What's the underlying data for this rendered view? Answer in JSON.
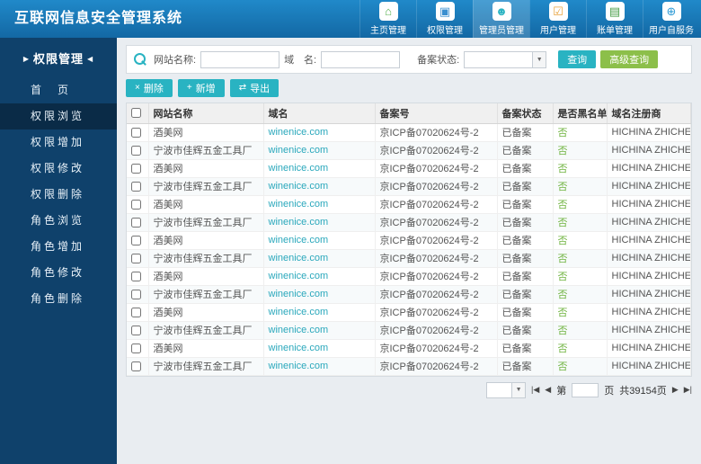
{
  "colors": {
    "teal": "#29b3c2",
    "green": "#8cbf4a",
    "link": "#2aa8bc",
    "ok_green": "#6fb33f"
  },
  "header": {
    "title": "互联网信息安全管理系统",
    "nav": [
      {
        "label": "主页管理",
        "icon": "home-icon",
        "glyph": "⌂",
        "color": "#55b04e",
        "active": false
      },
      {
        "label": "权限管理",
        "icon": "permission-icon",
        "glyph": "▣",
        "color": "#3a8fd0",
        "active": false
      },
      {
        "label": "管理员管理",
        "icon": "admin-icon",
        "glyph": "☻",
        "color": "#29b3c2",
        "active": true
      },
      {
        "label": "用户管理",
        "icon": "user-icon",
        "glyph": "☑",
        "color": "#e8a33d",
        "active": false
      },
      {
        "label": "账单管理",
        "icon": "billing-icon",
        "glyph": "▤",
        "color": "#4a9e4a",
        "active": false
      },
      {
        "label": "用户自服务",
        "icon": "globe-icon",
        "glyph": "⊕",
        "color": "#2f9bd6",
        "active": false
      }
    ]
  },
  "sidebar": {
    "title": "权限管理",
    "title_left_icon": "▶",
    "title_right_icon": "◀",
    "items": [
      {
        "label": "首　页",
        "active": false
      },
      {
        "label": "权限浏览",
        "active": true
      },
      {
        "label": "权限增加",
        "active": false
      },
      {
        "label": "权限修改",
        "active": false
      },
      {
        "label": "权限删除",
        "active": false
      },
      {
        "label": "角色浏览",
        "active": false
      },
      {
        "label": "角色增加",
        "active": false
      },
      {
        "label": "角色修改",
        "active": false
      },
      {
        "label": "角色删除",
        "active": false
      }
    ]
  },
  "search": {
    "site_name_label": "网站名称:",
    "site_name_value": "",
    "domain_label": "域　名:",
    "domain_value": "",
    "status_label": "备案状态:",
    "status_value": "",
    "query_button": "查询",
    "advanced_button": "高级查询"
  },
  "toolbar": {
    "delete_icon": "×",
    "delete_label": "删除",
    "add_icon": "+",
    "add_label": "新增",
    "export_icon": "⇄",
    "export_label": "导出"
  },
  "table": {
    "columns": [
      "网站名称",
      "域名",
      "备案号",
      "备案状态",
      "是否黑名单",
      "域名注册商"
    ],
    "rows": [
      {
        "name": "酒美网",
        "domain": "winenice.com",
        "record_no": "京ICP备07020624号-2",
        "status": "已备案",
        "blacklist": "否",
        "registrar": "HICHINA ZHICHENG TECHNOLOGY"
      },
      {
        "name": "宁波市佳辉五金工具厂",
        "domain": "winenice.com",
        "record_no": "京ICP备07020624号-2",
        "status": "已备案",
        "blacklist": "否",
        "registrar": "HICHINA ZHICHENG TECHNOLOGY"
      },
      {
        "name": "酒美网",
        "domain": "winenice.com",
        "record_no": "京ICP备07020624号-2",
        "status": "已备案",
        "blacklist": "否",
        "registrar": "HICHINA ZHICHENG TECHNOLOGY"
      },
      {
        "name": "宁波市佳辉五金工具厂",
        "domain": "winenice.com",
        "record_no": "京ICP备07020624号-2",
        "status": "已备案",
        "blacklist": "否",
        "registrar": "HICHINA ZHICHENG TECHNOLOGY"
      },
      {
        "name": "酒美网",
        "domain": "winenice.com",
        "record_no": "京ICP备07020624号-2",
        "status": "已备案",
        "blacklist": "否",
        "registrar": "HICHINA ZHICHENG TECHNOLOGY"
      },
      {
        "name": "宁波市佳辉五金工具厂",
        "domain": "winenice.com",
        "record_no": "京ICP备07020624号-2",
        "status": "已备案",
        "blacklist": "否",
        "registrar": "HICHINA ZHICHENG TECHNOLOGY"
      },
      {
        "name": "酒美网",
        "domain": "winenice.com",
        "record_no": "京ICP备07020624号-2",
        "status": "已备案",
        "blacklist": "否",
        "registrar": "HICHINA ZHICHENG TECHNOLOGY"
      },
      {
        "name": "宁波市佳辉五金工具厂",
        "domain": "winenice.com",
        "record_no": "京ICP备07020624号-2",
        "status": "已备案",
        "blacklist": "否",
        "registrar": "HICHINA ZHICHENG TECHNOLOGY"
      },
      {
        "name": "酒美网",
        "domain": "winenice.com",
        "record_no": "京ICP备07020624号-2",
        "status": "已备案",
        "blacklist": "否",
        "registrar": "HICHINA ZHICHENG TECHNOLOGY"
      },
      {
        "name": "宁波市佳辉五金工具厂",
        "domain": "winenice.com",
        "record_no": "京ICP备07020624号-2",
        "status": "已备案",
        "blacklist": "否",
        "registrar": "HICHINA ZHICHENG TECHNOLOGY"
      },
      {
        "name": "酒美网",
        "domain": "winenice.com",
        "record_no": "京ICP备07020624号-2",
        "status": "已备案",
        "blacklist": "否",
        "registrar": "HICHINA ZHICHENG TECHNOLOGY"
      },
      {
        "name": "宁波市佳辉五金工具厂",
        "domain": "winenice.com",
        "record_no": "京ICP备07020624号-2",
        "status": "已备案",
        "blacklist": "否",
        "registrar": "HICHINA ZHICHENG TECHNOLOGY"
      },
      {
        "name": "酒美网",
        "domain": "winenice.com",
        "record_no": "京ICP备07020624号-2",
        "status": "已备案",
        "blacklist": "否",
        "registrar": "HICHINA ZHICHENG TECHNOLOGY"
      },
      {
        "name": "宁波市佳辉五金工具厂",
        "domain": "winenice.com",
        "record_no": "京ICP备07020624号-2",
        "status": "已备案",
        "blacklist": "否",
        "registrar": "HICHINA ZHICHENG TECHNOLOGY"
      }
    ]
  },
  "pagination": {
    "first_icon": "|◀",
    "prev_icon": "◀",
    "next_icon": "▶",
    "last_icon": "▶|",
    "page_prefix": "第",
    "page_value": "",
    "page_suffix": "页",
    "total_text": "共39154页"
  }
}
